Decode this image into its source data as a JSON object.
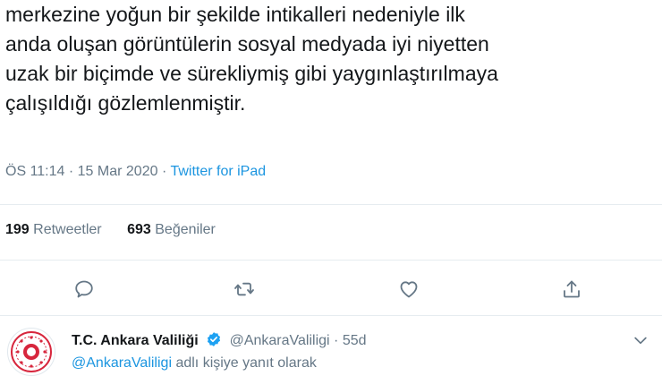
{
  "tweet": {
    "lines": [
      "merkezine yoğun bir şekilde intikalleri nedeniyle ilk",
      "anda oluşan görüntülerin sosyal medyada iyi niyetten",
      "uzak bir biçimde ve sürekliymiş gibi yaygınlaştırılmaya",
      "çalışıldığı gözlemlenmiştir."
    ],
    "time": "ÖS 11:14",
    "sep1": "·",
    "date": "15 Mar 2020",
    "sep2": "·",
    "source": "Twitter for iPad"
  },
  "stats": {
    "retweets_count": "199",
    "retweets_label": "Retweetler",
    "likes_count": "693",
    "likes_label": "Beğeniler"
  },
  "actions": {
    "icons": [
      "reply-icon",
      "retweet-icon",
      "like-icon",
      "share-icon"
    ]
  },
  "reply": {
    "name": "T.C. Ankara Valiliği",
    "handle": "@AnkaraValiligi",
    "sep": "·",
    "age": "55d",
    "replying_mention": "@AnkaraValiligi",
    "replying_suffix": "adlı kişiye yanıt olarak"
  },
  "colors": {
    "accent": "#1b95e0",
    "muted": "#657786",
    "text": "#14171a",
    "verified": "#1da1f2",
    "seal_red": "#d7263d"
  }
}
